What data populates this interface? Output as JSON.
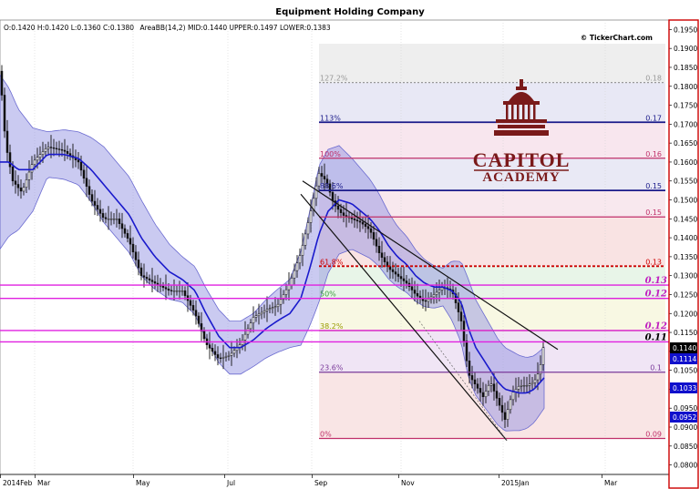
{
  "chart_data": {
    "type": "candlestick",
    "title": "Equipment Holding Company",
    "ohlc_info": "O:0.1420 H:0.1420 L:0.1360 C:0.1380",
    "indicator_info": "AreaBB(14,2) MID:0.1440 UPPER:0.1497 LOWER:0.1383",
    "watermark": "© TickerChart.com",
    "logo": {
      "line1": "CAPITOL",
      "line2": "ACADEMY"
    },
    "ylim": [
      0.0775,
      0.1975
    ],
    "y_ticks": [
      "0.1950",
      "0.1900",
      "0.1850",
      "0.1800",
      "0.1750",
      "0.1700",
      "0.1650",
      "0.1600",
      "0.1550",
      "0.1500",
      "0.1450",
      "0.1400",
      "0.1350",
      "0.1300",
      "0.1250",
      "0.1200",
      "0.1150",
      "0.1100",
      "0.1050",
      "0.1000",
      "0.0950",
      "0.0900",
      "0.0850",
      "0.0800"
    ],
    "x_ticks": [
      "2014Feb",
      "Mar",
      "May",
      "Jul",
      "Sep",
      "Nov",
      "2015Jan",
      "Mar"
    ],
    "price_tags": [
      {
        "value": 0.114,
        "text": "0.1140",
        "color": "#000000"
      },
      {
        "value": 0.1114,
        "text": "0.1114",
        "color": "#1010cc"
      },
      {
        "value": 0.1033,
        "text": "0.1033",
        "color": "#1010cc"
      },
      {
        "value": 0.0952,
        "text": "0.0952",
        "color": "#1010cc"
      }
    ],
    "fibonacci": [
      {
        "pct": "127.2%",
        "value": 0.181,
        "right": "0.18",
        "color": "#999999"
      },
      {
        "pct": "113%",
        "value": 0.1705,
        "right": "0.17",
        "color": "#1a1a8a"
      },
      {
        "pct": "100%",
        "value": 0.161,
        "right": "0.16",
        "color": "#c0306a"
      },
      {
        "pct": "88.6%",
        "value": 0.1525,
        "right": "0.15",
        "color": "#1a1a8a"
      },
      {
        "pct": "",
        "value": 0.1455,
        "right": "0.15",
        "color": "#c0306a"
      },
      {
        "pct": "61.8%",
        "value": 0.1325,
        "right": "0.13",
        "color": "#cc0000"
      },
      {
        "pct": "50%",
        "value": 0.124,
        "right": "",
        "color": "#3a9a3a"
      },
      {
        "pct": "38.2%",
        "value": 0.1155,
        "right": "",
        "color": "#999900"
      },
      {
        "pct": "23.6%",
        "value": 0.1045,
        "right": "0.1",
        "color": "#7a3a9a"
      },
      {
        "pct": "0%",
        "value": 0.087,
        "right": "0.09",
        "color": "#c0306a"
      }
    ],
    "horizontal_lines": [
      {
        "value": 0.1275,
        "label": "0.13"
      },
      {
        "value": 0.124,
        "label": "0.12"
      },
      {
        "value": 0.1155,
        "label": "0.12"
      },
      {
        "value": 0.1125,
        "label": "0.11"
      }
    ],
    "close_points": [
      [
        0,
        0.184
      ],
      [
        6,
        0.165
      ],
      [
        14,
        0.155
      ],
      [
        24,
        0.152
      ],
      [
        36,
        0.16
      ],
      [
        52,
        0.164
      ],
      [
        70,
        0.163
      ],
      [
        86,
        0.16
      ],
      [
        100,
        0.15
      ],
      [
        114,
        0.145
      ],
      [
        128,
        0.145
      ],
      [
        142,
        0.139
      ],
      [
        155,
        0.13
      ],
      [
        170,
        0.128
      ],
      [
        186,
        0.126
      ],
      [
        200,
        0.126
      ],
      [
        214,
        0.12
      ],
      [
        226,
        0.112
      ],
      [
        240,
        0.108
      ],
      [
        252,
        0.109
      ],
      [
        264,
        0.112
      ],
      [
        278,
        0.119
      ],
      [
        292,
        0.121
      ],
      [
        304,
        0.122
      ],
      [
        318,
        0.128
      ],
      [
        330,
        0.136
      ],
      [
        340,
        0.146
      ],
      [
        350,
        0.157
      ],
      [
        358,
        0.155
      ],
      [
        366,
        0.149
      ],
      [
        376,
        0.146
      ],
      [
        386,
        0.145
      ],
      [
        396,
        0.144
      ],
      [
        406,
        0.142
      ],
      [
        416,
        0.136
      ],
      [
        426,
        0.132
      ],
      [
        436,
        0.13
      ],
      [
        446,
        0.128
      ],
      [
        456,
        0.125
      ],
      [
        466,
        0.123
      ],
      [
        476,
        0.125
      ],
      [
        486,
        0.127
      ],
      [
        496,
        0.126
      ],
      [
        506,
        0.118
      ],
      [
        514,
        0.104
      ],
      [
        522,
        0.101
      ],
      [
        530,
        0.098
      ],
      [
        538,
        0.102
      ],
      [
        546,
        0.097
      ],
      [
        554,
        0.092
      ],
      [
        562,
        0.099
      ],
      [
        570,
        0.101
      ],
      [
        578,
        0.101
      ],
      [
        586,
        0.102
      ],
      [
        592,
        0.105
      ],
      [
        598,
        0.114
      ]
    ],
    "mid_points": [
      [
        0,
        0.16
      ],
      [
        10,
        0.16
      ],
      [
        20,
        0.158
      ],
      [
        36,
        0.158
      ],
      [
        52,
        0.162
      ],
      [
        70,
        0.162
      ],
      [
        86,
        0.161
      ],
      [
        100,
        0.158
      ],
      [
        114,
        0.154
      ],
      [
        128,
        0.15
      ],
      [
        142,
        0.146
      ],
      [
        155,
        0.14
      ],
      [
        170,
        0.135
      ],
      [
        186,
        0.131
      ],
      [
        200,
        0.129
      ],
      [
        214,
        0.126
      ],
      [
        226,
        0.12
      ],
      [
        240,
        0.114
      ],
      [
        252,
        0.111
      ],
      [
        264,
        0.111
      ],
      [
        278,
        0.113
      ],
      [
        292,
        0.116
      ],
      [
        304,
        0.118
      ],
      [
        318,
        0.12
      ],
      [
        330,
        0.124
      ],
      [
        340,
        0.132
      ],
      [
        350,
        0.141
      ],
      [
        360,
        0.147
      ],
      [
        372,
        0.15
      ],
      [
        386,
        0.149
      ],
      [
        396,
        0.147
      ],
      [
        406,
        0.145
      ],
      [
        416,
        0.142
      ],
      [
        426,
        0.138
      ],
      [
        436,
        0.135
      ],
      [
        446,
        0.133
      ],
      [
        456,
        0.13
      ],
      [
        466,
        0.128
      ],
      [
        476,
        0.127
      ],
      [
        486,
        0.127
      ],
      [
        496,
        0.126
      ],
      [
        506,
        0.123
      ],
      [
        514,
        0.116
      ],
      [
        522,
        0.111
      ],
      [
        530,
        0.108
      ],
      [
        538,
        0.105
      ],
      [
        546,
        0.102
      ],
      [
        554,
        0.1
      ],
      [
        562,
        0.0995
      ],
      [
        570,
        0.099
      ],
      [
        578,
        0.099
      ],
      [
        586,
        0.1
      ],
      [
        598,
        0.1033
      ]
    ],
    "band_half_width": [
      [
        0,
        0.023
      ],
      [
        20,
        0.016
      ],
      [
        52,
        0.006
      ],
      [
        86,
        0.007
      ],
      [
        114,
        0.01
      ],
      [
        155,
        0.01
      ],
      [
        200,
        0.006
      ],
      [
        240,
        0.007
      ],
      [
        278,
        0.007
      ],
      [
        318,
        0.009
      ],
      [
        350,
        0.018
      ],
      [
        386,
        0.012
      ],
      [
        436,
        0.008
      ],
      [
        486,
        0.005
      ],
      [
        514,
        0.013
      ],
      [
        554,
        0.011
      ],
      [
        598,
        0.008
      ]
    ]
  }
}
